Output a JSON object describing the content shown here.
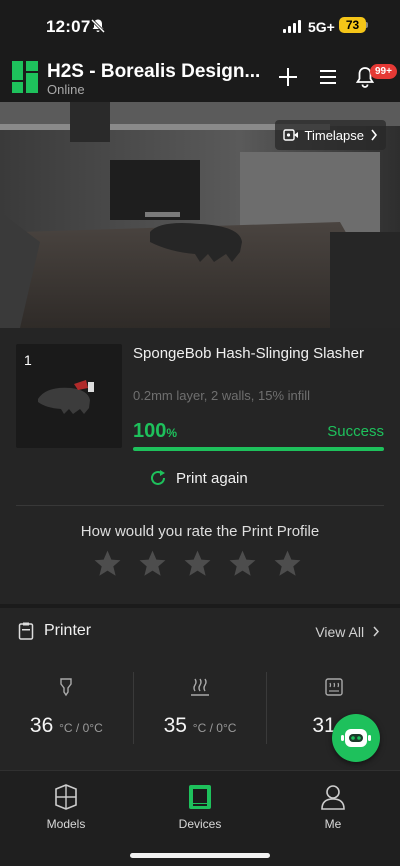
{
  "status_bar": {
    "time": "12:07",
    "network": "5G+",
    "battery": "73"
  },
  "header": {
    "device_name": "H2S - Borealis Design...",
    "device_status": "Online",
    "notification_badge": "99+"
  },
  "camera": {
    "timelapse_label": "Timelapse"
  },
  "job": {
    "index": "1",
    "title": "SpongeBob Hash-Slinging Slasher",
    "meta": "0.2mm layer, 2 walls, 15% infill",
    "progress_value": "100",
    "progress_unit": "%",
    "progress_fraction": 1.0,
    "result": "Success",
    "print_again_label": "Print again",
    "rate_prompt": "How would you rate the Print Profile",
    "rating": 0,
    "rating_max": 5
  },
  "printer": {
    "title": "Printer",
    "view_all": "View All",
    "temperatures": [
      {
        "icon": "nozzle-icon",
        "value": "36",
        "unit": "°C / 0°C"
      },
      {
        "icon": "heatbed-icon",
        "value": "35",
        "unit": "°C / 0°C"
      },
      {
        "icon": "chamber-icon",
        "value": "31",
        "unit": "°C"
      }
    ]
  },
  "tabs": [
    {
      "label": "Models",
      "icon": "models-icon"
    },
    {
      "label": "Devices",
      "icon": "devices-icon"
    },
    {
      "label": "Me",
      "icon": "profile-icon"
    }
  ],
  "colors": {
    "accent": "#1ec15c",
    "badge": "#e53935",
    "background": "#1b1b1b",
    "card": "#252525"
  }
}
